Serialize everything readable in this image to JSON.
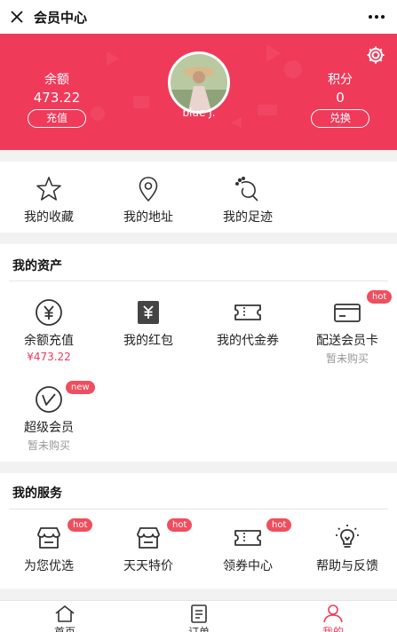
{
  "topbar": {
    "title": "会员中心",
    "close_icon": "close-icon",
    "more_icon": "more-dots-icon"
  },
  "hero": {
    "background": "#f03a5a",
    "balance": {
      "label": "余额",
      "value": "473.22",
      "button": "充值"
    },
    "points": {
      "label": "积分",
      "value": "0",
      "button": "兑换"
    },
    "username": "blue J.",
    "settings_icon": "gear-icon"
  },
  "quick": [
    {
      "label": "我的收藏",
      "icon": "star-icon"
    },
    {
      "label": "我的地址",
      "icon": "location-pin-icon"
    },
    {
      "label": "我的足迹",
      "icon": "footprint-icon"
    }
  ],
  "assets": {
    "title": "我的资产",
    "items": [
      {
        "label": "余额充值",
        "sub": "¥473.22",
        "icon": "yuan-circle-icon",
        "badge": ""
      },
      {
        "label": "我的红包",
        "sub": "",
        "icon": "red-packet-icon",
        "badge": ""
      },
      {
        "label": "我的代金券",
        "sub": "",
        "icon": "voucher-icon",
        "badge": ""
      },
      {
        "label": "配送会员卡",
        "sub": "暂未购买",
        "icon": "delivery-card-icon",
        "badge": "hot"
      },
      {
        "label": "超级会员",
        "sub": "暂未购买",
        "icon": "super-vip-icon",
        "badge": "new"
      }
    ]
  },
  "services": {
    "title": "我的服务",
    "items": [
      {
        "label": "为您优选",
        "icon": "shop-icon",
        "badge": "hot"
      },
      {
        "label": "天天特价",
        "icon": "shop-icon",
        "badge": "hot"
      },
      {
        "label": "领券中心",
        "icon": "coupon-icon",
        "badge": "hot"
      },
      {
        "label": "帮助与反馈",
        "icon": "lightbulb-icon",
        "badge": ""
      }
    ]
  },
  "tabbar": [
    {
      "label": "首页",
      "icon": "home-icon",
      "active": false
    },
    {
      "label": "订单",
      "icon": "order-list-icon",
      "active": false
    },
    {
      "label": "我的",
      "icon": "user-icon",
      "active": true
    }
  ]
}
